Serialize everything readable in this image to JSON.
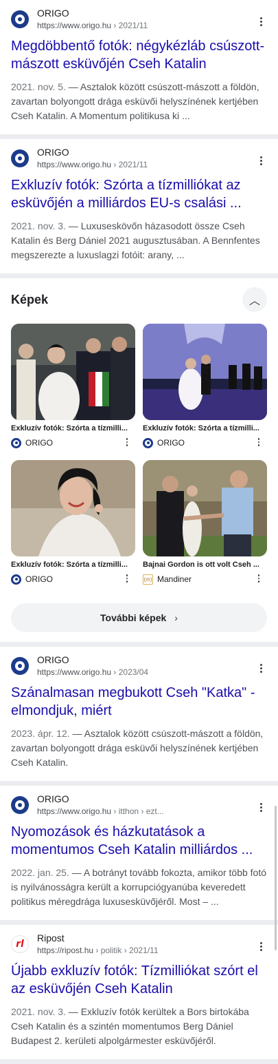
{
  "results": [
    {
      "source": "ORIGO",
      "url": "https://www.origo.hu",
      "breadcrumb": " › 2021/11",
      "title": "Megdöbbentő fotók: négykézláb csúszott-mászott esküvőjén Cseh Katalin",
      "date": "2021. nov. 5.",
      "snippet": " — Asztalok között csúszott-mászott a földön, zavartan bolyongott drága esküvői helyszínének kertjében Cseh Katalin. A Momentum politikusa ki ..."
    },
    {
      "source": "ORIGO",
      "url": "https://www.origo.hu",
      "breadcrumb": " › 2021/11",
      "title": "Exkluzív fotók: Szórta a tízmilliókat az esküvőjén a milliárdos EU-s csalási ...",
      "date": "2021. nov. 3.",
      "snippet": " — Luxuseskövőn házasodott össze Cseh Katalin és Berg Dániel 2021 augusztusában. A Bennfentes megszerezte a luxuslagzi fotóit: arany, ..."
    },
    {
      "source": "ORIGO",
      "url": "https://www.origo.hu",
      "breadcrumb": " › 2023/04",
      "title": "Szánalmasan megbukott Cseh \"Katka\" - elmondjuk, miért",
      "date": "2023. ápr. 12.",
      "snippet": " — Asztalok között csúszott-mászott a földön, zavartan bolyongott drága esküvői helyszínének kertjében Cseh Katalin."
    },
    {
      "source": "ORIGO",
      "url": "https://www.origo.hu",
      "breadcrumb": " › itthon › ezt...",
      "title": "Nyomozások és házkutatások a momentumos Cseh Katalin milliárdos ...",
      "date": "2022. jan. 25.",
      "snippet": " — A botrányt tovább fokozta, amikor több fotó is nyilvánosságra került a korrupciógyanúba keveredett politikus méregdrága luxusesküvőjéről. Most – ..."
    },
    {
      "source": "Ripost",
      "url": "https://ripost.hu",
      "breadcrumb": " › politik › 2021/11",
      "title": "Újabb exkluzív fotók: Tízmilliókat szórt el az esküvőjén Cseh Katalin",
      "date": "2021. nov. 3.",
      "snippet": " — Exkluzív fotók kerültek a Bors birtokába Cseh Katalin és a szintén momentumos Berg Dániel Budapest 2. kerületi alpolgármester esküvőjéről."
    }
  ],
  "images": {
    "heading": "Képek",
    "more_label": "További képek",
    "items": [
      {
        "caption": "Exkluzív fotók: Szórta a tízmilli...",
        "source": "ORIGO",
        "icon": "origo-favicon"
      },
      {
        "caption": "Exkluzív fotók: Szórta a tízmilli...",
        "source": "ORIGO",
        "icon": "origo-favicon"
      },
      {
        "caption": "Exkluzív fotók: Szórta a tízmilli...",
        "source": "ORIGO",
        "icon": "origo-favicon"
      },
      {
        "caption": "Bajnai Gordon is ott volt Cseh ...",
        "source": "Mandiner",
        "icon": "mandiner-favicon"
      }
    ]
  },
  "colors": {
    "link": "#1a0dab",
    "divider": "#ebedf0",
    "origo": "#1c3b8a",
    "ripost": "#e3161c"
  },
  "icons": {
    "menu": "more-vert-icon",
    "collapse": "chevron-up-icon",
    "more": "chevron-right-icon"
  }
}
